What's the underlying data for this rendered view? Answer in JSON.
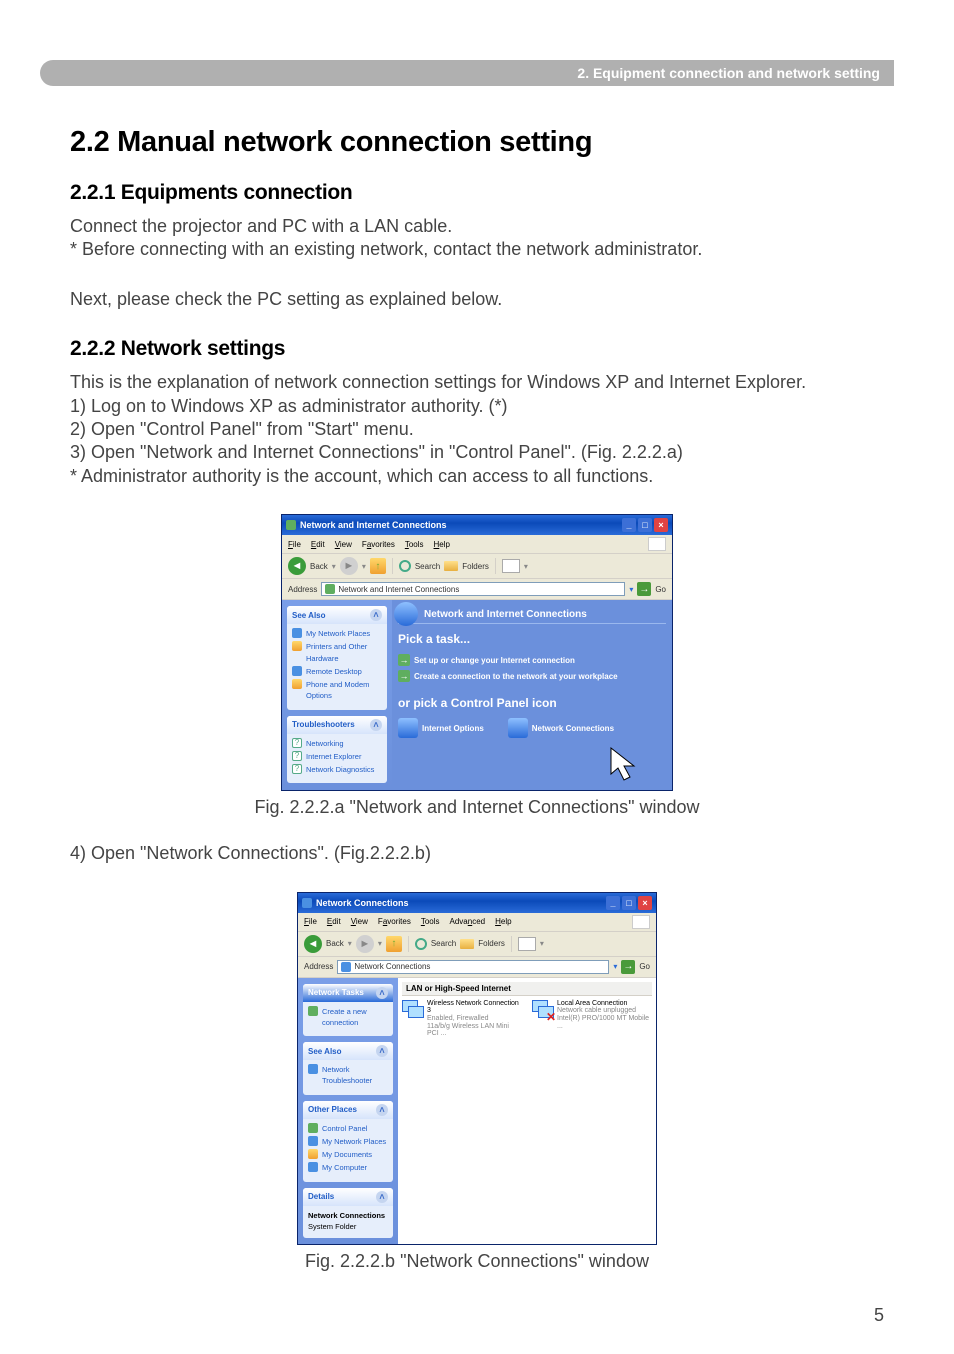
{
  "header_bar": "2. Equipment connection and network setting",
  "h1": "2.2 Manual network connection setting",
  "s1": {
    "h2": "2.2.1 Equipments connection",
    "p1": "Connect the projector and PC with a LAN cable.",
    "p2": "* Before connecting with an existing network, contact the network administrator.",
    "p3": "Next, please check the PC setting as explained below."
  },
  "s2": {
    "h2": "2.2.2 Network settings",
    "p1": "This is the explanation of network connection settings for Windows XP and Internet Explorer.",
    "p2": "1) Log on to Windows XP as administrator authority. (*)",
    "p3": "2) Open \"Control Panel\" from \"Start\" menu.",
    "p4": "3) Open \"Network and Internet Connections\" in \"Control Panel\". (Fig. 2.2.2.a)",
    "p5": "* Administrator authority is the account, which can access to all functions."
  },
  "fig_a_caption": "Fig. 2.2.2.a \"Network and Internet Connections\" window",
  "s3": {
    "p1": "4) Open \"Network Connections\". (Fig.2.2.2.b)"
  },
  "fig_b_caption": "Fig. 2.2.2.b \"Network Connections\" window",
  "page_number": "5",
  "win_a": {
    "title": "Network and Internet Connections",
    "menus": {
      "file": "File",
      "edit": "Edit",
      "view": "View",
      "favorites": "Favorites",
      "tools": "Tools",
      "help": "Help"
    },
    "toolbar": {
      "back": "Back",
      "search": "Search",
      "folders": "Folders"
    },
    "address_label": "Address",
    "address_value": "Network and Internet Connections",
    "go": "Go",
    "side": {
      "see_also_hdr": "See Also",
      "see_also_items": {
        "i0": "My Network Places",
        "i1": "Printers and Other Hardware",
        "i2": "Remote Desktop",
        "i3": "Phone and Modem Options"
      },
      "troubleshooters_hdr": "Troubleshooters",
      "troubleshooters_items": {
        "i0": "Networking",
        "i1": "Internet Explorer",
        "i2": "Network Diagnostics"
      }
    },
    "main": {
      "hdr": "Network and Internet Connections",
      "pick": "Pick a task...",
      "task1": "Set up or change your Internet connection",
      "task2": "Create a connection to the network at your workplace",
      "orpick": "or pick a Control Panel icon",
      "cp1": "Internet Options",
      "cp2": "Network Connections"
    }
  },
  "win_b": {
    "title": "Network Connections",
    "menus": {
      "file": "File",
      "edit": "Edit",
      "view": "View",
      "favorites": "Favorites",
      "tools": "Tools",
      "advanced": "Advanced",
      "help": "Help"
    },
    "toolbar": {
      "back": "Back",
      "search": "Search",
      "folders": "Folders"
    },
    "address_label": "Address",
    "address_value": "Network Connections",
    "go": "Go",
    "side": {
      "tasks_hdr": "Network Tasks",
      "tasks_items": {
        "i0": "Create a new connection"
      },
      "see_also_hdr": "See Also",
      "see_also_items": {
        "i0": "Network Troubleshooter"
      },
      "other_hdr": "Other Places",
      "other_items": {
        "i0": "Control Panel",
        "i1": "My Network Places",
        "i2": "My Documents",
        "i3": "My Computer"
      },
      "details_hdr": "Details",
      "details_title": "Network Connections",
      "details_sub": "System Folder"
    },
    "main": {
      "group": "LAN or High-Speed Internet",
      "conn1": {
        "name": "Wireless Network Connection 3",
        "status": "Enabled, Firewalled",
        "device": "11a/b/g Wireless LAN Mini PCI ..."
      },
      "conn2": {
        "name": "Local Area Connection",
        "status": "Network cable unplugged",
        "device": "Intel(R) PRO/1000 MT Mobile ..."
      }
    }
  }
}
